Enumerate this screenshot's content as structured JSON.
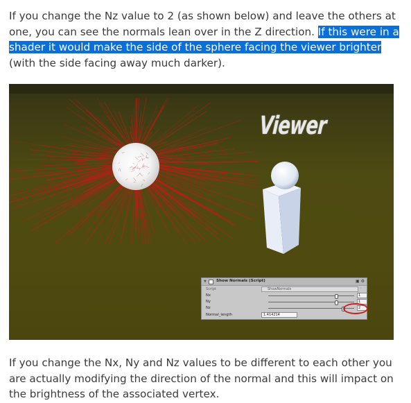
{
  "text_top": {
    "plain_1": "If you change the Nz value to 2 (as shown below) and leave the others at one, you can see the normals lean over in the Z direction. ",
    "highlighted": "If this were in a shader it would make the side of the sphere facing the viewer brighter",
    "plain_2": " (with the side facing away much darker)."
  },
  "text_bottom": "If you change the Nx, Ny and Nz values to be different to each other you are actually modifying the direction of the normal and this will impact on the brightness of the associated vertex.",
  "scene": {
    "viewer_label": "Viewer",
    "colors": {
      "ground": "#4f4b10",
      "normals": "#c81818",
      "highlight": "#0a6fd9"
    }
  },
  "inspector": {
    "fold_glyph": "▼",
    "component_title": "Show Normals (Script)",
    "header_icons": "▣ ⚙",
    "script_label": "Script",
    "script_value": "ShowNormals",
    "script_dot": "◦",
    "rows": [
      {
        "label": "Nx",
        "value": "1",
        "fraction": 0.78
      },
      {
        "label": "Ny",
        "value": "1",
        "fraction": 0.78
      },
      {
        "label": "Nz",
        "value": "2",
        "fraction": 0.85
      }
    ],
    "length_label": "Normal_length",
    "length_value": "1.414214"
  }
}
